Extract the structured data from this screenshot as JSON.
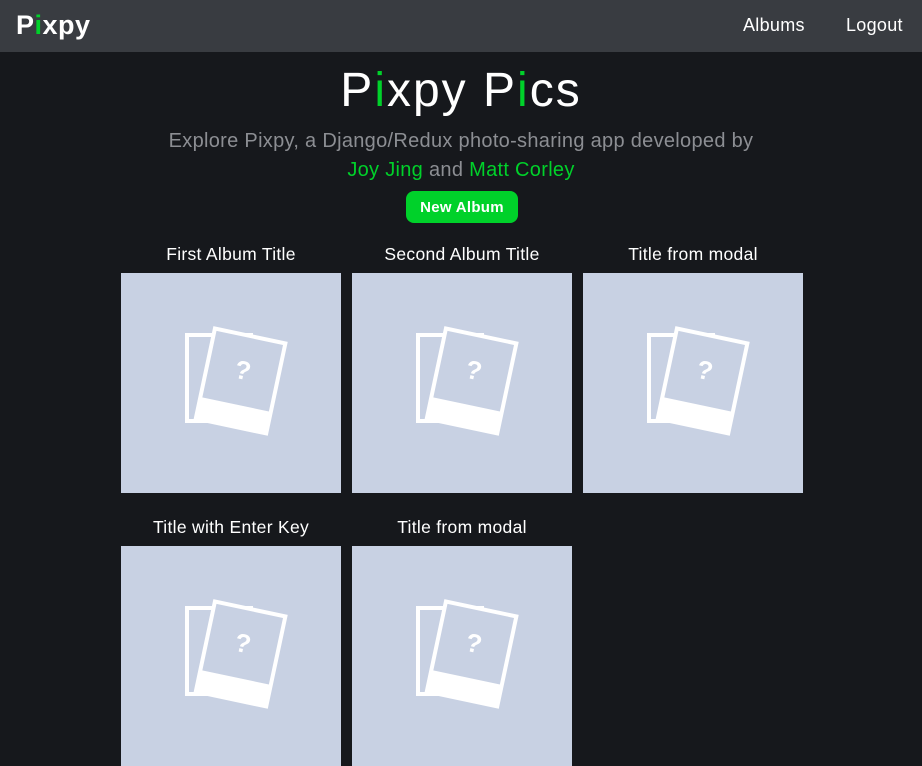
{
  "navbar": {
    "brand_prefix": "P",
    "brand_accent": "i",
    "brand_suffix": "xpy",
    "links": {
      "albums": "Albums",
      "logout": "Logout"
    }
  },
  "hero": {
    "title_p1": "P",
    "title_i1": "i",
    "title_mid": "xpy P",
    "title_i2": "i",
    "title_end": "cs",
    "subtitle": "Explore Pixpy, a Django/Redux photo-sharing app developed by",
    "author1": "Joy Jing",
    "conjunction": "and",
    "author2": "Matt Corley",
    "new_album_label": "New Album"
  },
  "albums": [
    {
      "title": "First Album Title"
    },
    {
      "title": "Second Album Title"
    },
    {
      "title": "Title from modal"
    },
    {
      "title": "Title with Enter Key"
    },
    {
      "title": "Title from modal"
    }
  ],
  "placeholder_icon": "photo-placeholder-icon",
  "placeholder_glyph": "?",
  "colors": {
    "background": "#16181c",
    "navbar": "#393c41",
    "accent": "#00d12a",
    "muted_text": "#8c8e93",
    "thumbnail": "#c8d1e3"
  }
}
